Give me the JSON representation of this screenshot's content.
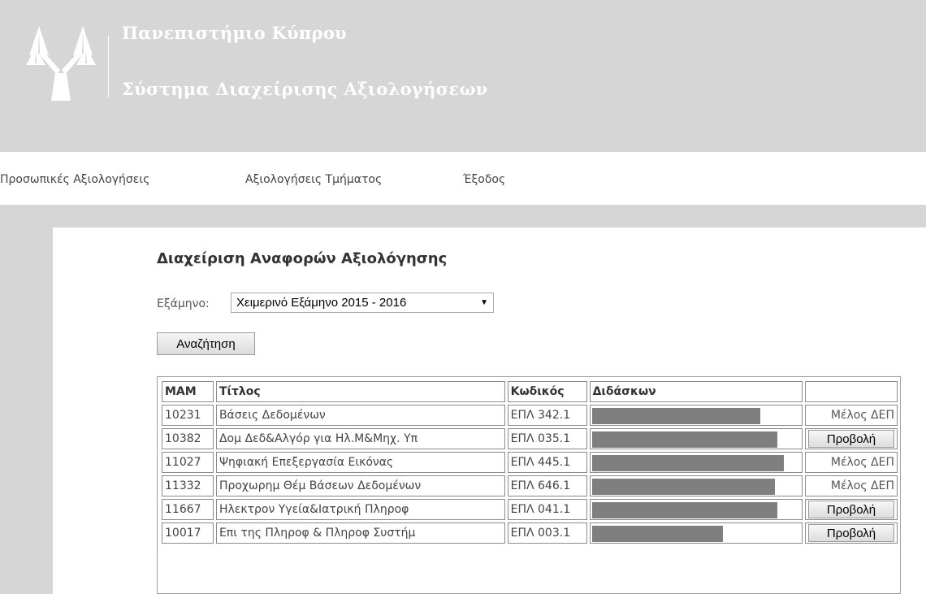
{
  "header": {
    "university": "Πανεπιστήμιο Κύπρου",
    "system": "Σύστημα Διαχείρισης Αξιολογήσεων",
    "logo": "university-tree-logo"
  },
  "nav": {
    "items": [
      {
        "label": "Προσωπικές Αξιολογήσεις"
      },
      {
        "label": "Αξιολογήσεις Τμήματος"
      },
      {
        "label": "Έξοδος"
      }
    ]
  },
  "main": {
    "title": "Διαχείριση Αναφορών Αξιολόγησης",
    "semester_label": "Εξάμηνο:",
    "semester_value": "Χειμερινό Εξάμηνο 2015 - 2016",
    "search_label": "Αναζήτηση"
  },
  "table": {
    "columns": [
      "ΜΑΜ",
      "Τίτλος",
      "Κωδικός",
      "Διδάσκων",
      ""
    ],
    "rows": [
      {
        "mam": "10231",
        "title": "Βάσεις Δεδομένων",
        "code": "ΕΠΛ 342.1",
        "instructor_redacted": 0.8,
        "action": "Μέλος ΔΕΠ",
        "action_type": "text"
      },
      {
        "mam": "10382",
        "title": "Δομ Δεδ&Αλγόρ για Ηλ.Μ&Μηχ. Υπ",
        "code": "ΕΠΛ 035.1",
        "instructor_redacted": 0.88,
        "action": "Προβολή",
        "action_type": "button"
      },
      {
        "mam": "11027",
        "title": "Ψηφιακή Επεξεργασία Εικόνας",
        "code": "ΕΠΛ 445.1",
        "instructor_redacted": 0.91,
        "action": "Μέλος ΔΕΠ",
        "action_type": "text"
      },
      {
        "mam": "11332",
        "title": "Προχωρημ Θέμ Βάσεων Δεδομένων",
        "code": "ΕΠΛ 646.1",
        "instructor_redacted": 0.87,
        "action": "Μέλος ΔΕΠ",
        "action_type": "text"
      },
      {
        "mam": "11667",
        "title": "Ηλεκτρον Υγεία&Ιατρική Πληροφ",
        "code": "ΕΠΛ 041.1",
        "instructor_redacted": 0.88,
        "action": "Προβολή",
        "action_type": "button"
      },
      {
        "mam": "10017",
        "title": "Επι της Πληροφ & Πληροφ Συστήμ",
        "code": "ΕΠΛ 003.1",
        "instructor_redacted": 0.62,
        "action": "Προβολή",
        "action_type": "button"
      }
    ]
  },
  "colors": {
    "header_bg": "#d6d6d6",
    "redaction": "#7f7f7f",
    "border": "#8a8a8a"
  }
}
